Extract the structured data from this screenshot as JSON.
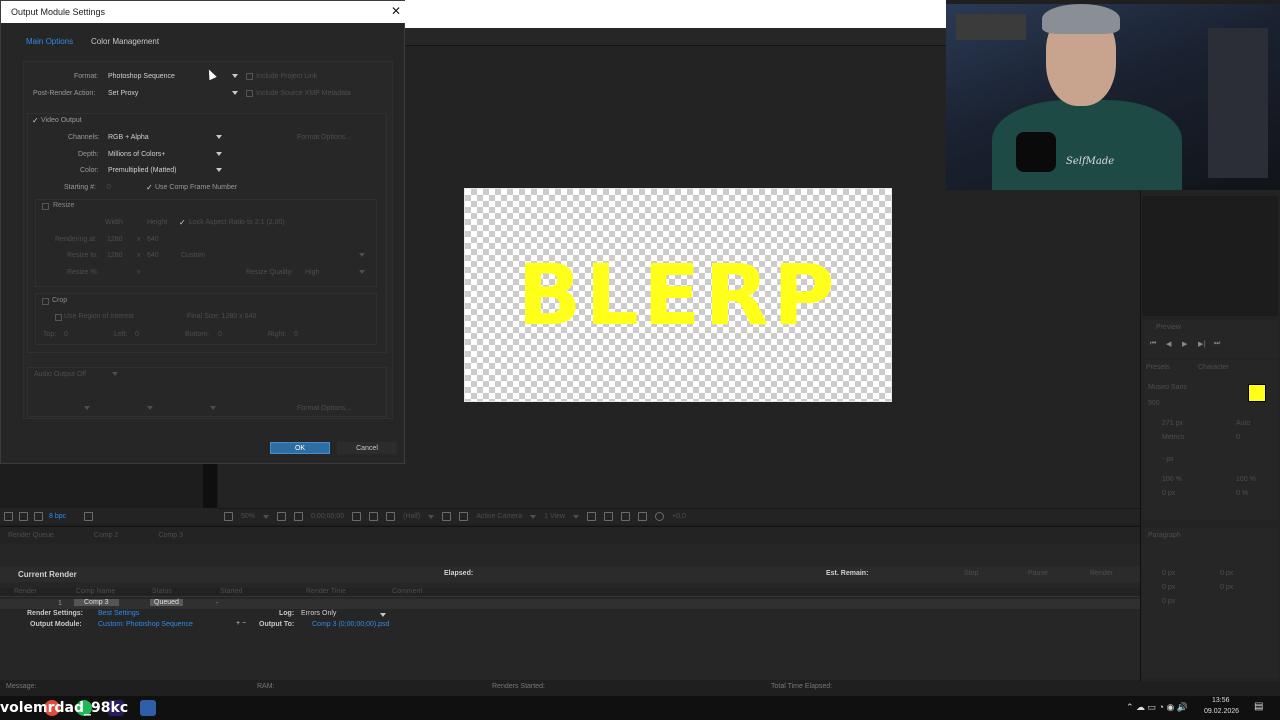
{
  "dialog": {
    "title": "Output Module Settings",
    "tabs": [
      "Main Options",
      "Color Management"
    ],
    "format_label": "Format:",
    "format_value": "Photoshop Sequence",
    "include_project_link": "Include Project Link",
    "post_render_label": "Post-Render Action:",
    "post_render_value": "Set Proxy",
    "include_xmp": "Include Source XMP Metadata",
    "video_output": "Video Output",
    "channels_label": "Channels:",
    "channels_value": "RGB + Alpha",
    "format_options": "Format Options...",
    "depth_label": "Depth:",
    "depth_value": "Millions of Colors+",
    "color_label": "Color:",
    "color_value": "Premultiplied (Matted)",
    "starting_label": "Starting #:",
    "starting_value": "0",
    "use_comp_frame": "Use Comp Frame Number",
    "resize": "Resize",
    "width": "Width",
    "height": "Height",
    "lock_aspect": "Lock Aspect Ratio to 2:1 (2,00)",
    "rendering_at": "Rendering at:",
    "render_w": "1280",
    "render_h": "640",
    "resize_to": "Resize to:",
    "resize_w": "1280",
    "resize_h": "640",
    "custom": "Custom",
    "resize_pct": "Resize %:",
    "x": "x",
    "resize_quality": "Resize Quality:",
    "quality_value": "High",
    "crop": "Crop",
    "use_roi": "Use Region of Interest",
    "final_size": "Final Size: 1280 x 640",
    "top": "Top:",
    "left": "Left:",
    "bottom": "Bottom:",
    "right": "Right:",
    "zero": "0",
    "audio_output": "Audio Output Off",
    "audio_format_options": "Format Options...",
    "ok": "OK",
    "cancel": "Cancel"
  },
  "viewer": {
    "canvas_text": "BLERP",
    "zoom": "50%",
    "timecode": "0;00;00;00",
    "resolution": "(Half)",
    "camera": "Active Camera",
    "views": "1 View",
    "exposure": "+0,0",
    "bpc": "8 bpc"
  },
  "right_panels": {
    "preview": "Preview",
    "presets": "Presets",
    "character": "Character",
    "font": "Museo Sans",
    "weight": "900",
    "size": "271 px",
    "auto": "Auto",
    "metrics": "Metrics",
    "zero": "0",
    "px": "- px",
    "pct100a": "100 %",
    "pct100b": "100 %",
    "px0": "0 px",
    "pct0": "0 %",
    "paragraph": "Paragraph",
    "p0a": "0 px",
    "p0b": "0 px",
    "p0c": "0 px",
    "p0d": "0 px",
    "p0e": "0 px"
  },
  "webcam": {
    "shirt_text": "SelfMade"
  },
  "render_queue": {
    "tabs": [
      "Render Queue",
      "Comp 2",
      "Comp 3"
    ],
    "current_render": "Current Render",
    "elapsed": "Elapsed:",
    "est_remain": "Est. Remain:",
    "stop": "Stop",
    "pause": "Pause",
    "render": "Render",
    "headers": [
      "Render",
      "Comp Name",
      "Status",
      "Started",
      "Render Time",
      "Comment"
    ],
    "row": {
      "num": "1",
      "comp": "Comp 3",
      "status": "Queued",
      "started": "-"
    },
    "render_settings_label": "Render Settings:",
    "render_settings_value": "Best Settings",
    "log_label": "Log:",
    "log_value": "Errors Only",
    "output_module_label": "Output Module:",
    "output_module_value": "Custom: Photoshop Sequence",
    "output_to_label": "Output To:",
    "output_to_value": "Comp 3 (0;00;00;00).psd"
  },
  "status_bar": {
    "message": "Message:",
    "ram": "RAM:",
    "renders_started": "Renders Started:",
    "total_elapsed": "Total Time Elapsed:"
  },
  "taskbar": {
    "channel": "volemrdad_98kc",
    "time": "13:56",
    "date": "09.02.2026"
  },
  "colors": {
    "accent": "#2d8ceb",
    "ok_button": "#2d6fa4",
    "text_yellow": "#ffff1a"
  }
}
